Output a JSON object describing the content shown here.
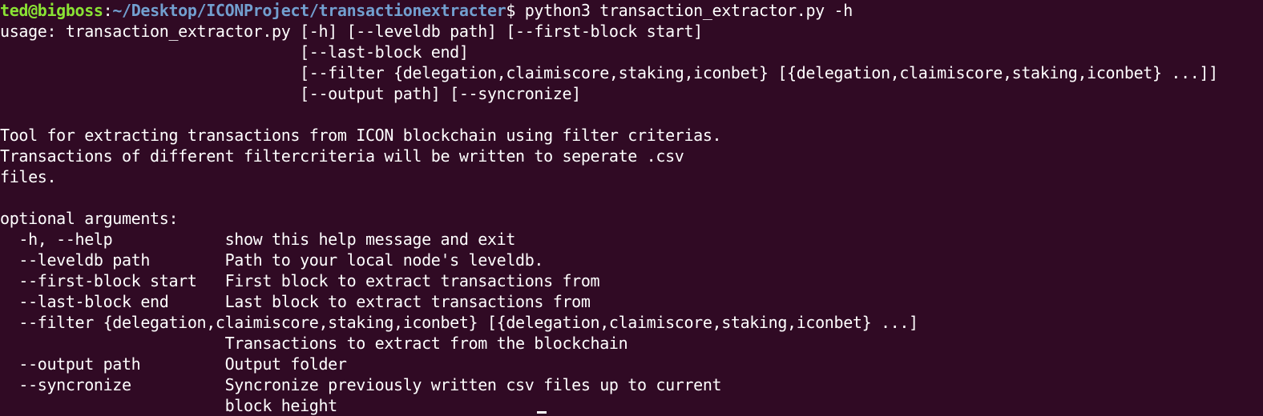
{
  "prompt": {
    "user_host": "ted@bigboss",
    "separator": ":",
    "cwd": "~/Desktop/ICONProject/transactionextracter",
    "symbol": "$",
    "command": " python3 transaction_extractor.py -h"
  },
  "output_lines": [
    "usage: transaction_extractor.py [-h] [--leveldb path] [--first-block start]",
    "                                [--last-block end]",
    "                                [--filter {delegation,claimiscore,staking,iconbet} [{delegation,claimiscore,staking,iconbet} ...]]",
    "                                [--output path] [--syncronize]",
    "",
    "Tool for extracting transactions from ICON blockchain using filter criterias.",
    "Transactions of different filtercriteria will be written to seperate .csv",
    "files.",
    "",
    "optional arguments:",
    "  -h, --help            show this help message and exit",
    "  --leveldb path        Path to your local node's leveldb.",
    "  --first-block start   First block to extract transactions from",
    "  --last-block end      Last block to extract transactions from",
    "  --filter {delegation,claimiscore,staking,iconbet} [{delegation,claimiscore,staking,iconbet} ...]",
    "                        Transactions to extract from the blockchain",
    "  --output path         Output folder",
    "  --syncronize          Syncronize previously written csv files up to current",
    "                        block height"
  ]
}
